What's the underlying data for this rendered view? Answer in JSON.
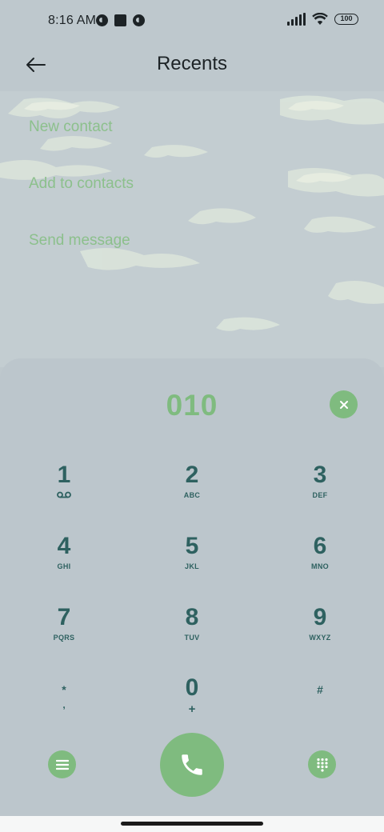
{
  "status_bar": {
    "time": "8:16 AM",
    "battery": "100",
    "icons_left": [
      "app-notification-icon",
      "square-app-icon",
      "app-notification-icon"
    ],
    "icons_right": [
      "cellular-signal-icon",
      "wifi-icon",
      "battery-icon"
    ]
  },
  "header": {
    "title": "Recents",
    "back_icon": "arrow-left-icon"
  },
  "options": {
    "new_contact": "New contact",
    "add_to_contacts": "Add to contacts",
    "send_message": "Send message"
  },
  "dialpad": {
    "number": "010",
    "clear_icon": "close-icon",
    "keys": [
      {
        "digit": "1",
        "sub": ""
      },
      {
        "digit": "2",
        "sub": "ABC"
      },
      {
        "digit": "3",
        "sub": "DEF"
      },
      {
        "digit": "4",
        "sub": "GHI"
      },
      {
        "digit": "5",
        "sub": "JKL"
      },
      {
        "digit": "6",
        "sub": "MNO"
      },
      {
        "digit": "7",
        "sub": "PQRS"
      },
      {
        "digit": "8",
        "sub": "TUV"
      },
      {
        "digit": "9",
        "sub": "WXYZ"
      },
      {
        "digit": "*",
        "sub": ","
      },
      {
        "digit": "0",
        "sub": "+"
      },
      {
        "digit": "#",
        "sub": ""
      }
    ],
    "voicemail_icon": "voicemail-icon",
    "menu_icon": "menu-icon",
    "call_icon": "phone-icon",
    "keypad_icon": "dialpad-icon"
  },
  "colors": {
    "accent": "#7fbb7f",
    "key_text": "#2e6160",
    "option_text": "#8cc08c"
  }
}
